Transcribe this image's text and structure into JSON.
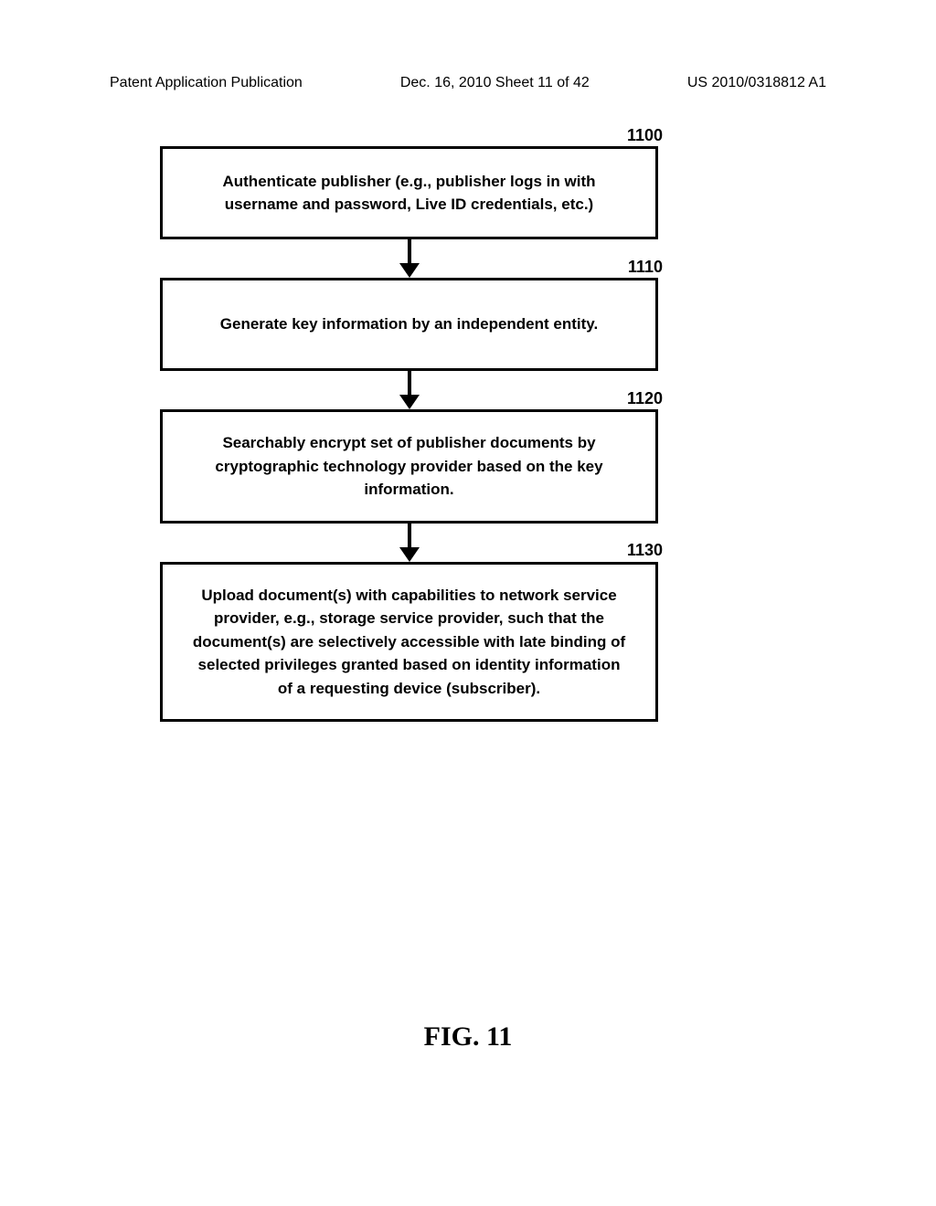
{
  "header": {
    "left": "Patent Application Publication",
    "center": "Dec. 16, 2010  Sheet 11 of 42",
    "right": "US 2010/0318812 A1"
  },
  "flowchart": {
    "boxes": [
      {
        "label": "1100",
        "text": "Authenticate publisher (e.g., publisher logs in with username and password, Live ID credentials, etc.)"
      },
      {
        "label": "1110",
        "text": "Generate key information by an independent entity."
      },
      {
        "label": "1120",
        "text": "Searchably encrypt set of publisher documents  by cryptographic technology provider based on the key information."
      },
      {
        "label": "1130",
        "text": "Upload document(s) with capabilities to network service provider, e.g., storage service provider, such that the document(s) are selectively accessible with late binding of selected privileges granted based on identity information of a requesting device (subscriber)."
      }
    ]
  },
  "figure": {
    "label": "FIG. 11"
  }
}
